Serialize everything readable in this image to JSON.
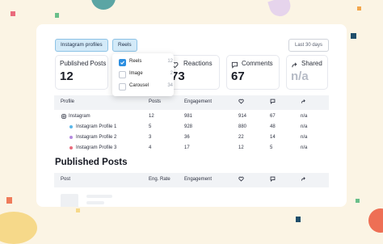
{
  "filters": {
    "account_chip": "Instagram profiles",
    "type_chip": "Reels",
    "date_range": "Last 30 days"
  },
  "stats": [
    {
      "label": "Published Posts",
      "value": "12"
    },
    {
      "label": "Reactions",
      "value": "73"
    },
    {
      "label": "Comments",
      "value": "67"
    },
    {
      "label": "Shared",
      "value": "n/a"
    }
  ],
  "profiles_table": {
    "headers": [
      "Profile",
      "Posts",
      "Engagement"
    ],
    "rows": [
      {
        "name": "Instagram",
        "posts": "12",
        "engagement": "981",
        "reactions": "914",
        "comments": "67",
        "shared": "n/a"
      },
      {
        "name": "Instagram Profile 1",
        "posts": "5",
        "engagement": "928",
        "reactions": "880",
        "comments": "48",
        "shared": "n/a"
      },
      {
        "name": "Instagram Profile 2",
        "posts": "3",
        "engagement": "36",
        "reactions": "22",
        "comments": "14",
        "shared": "n/a"
      },
      {
        "name": "Instagram Profile 3",
        "posts": "4",
        "engagement": "17",
        "reactions": "12",
        "comments": "5",
        "shared": "n/a"
      }
    ],
    "profile_colors": [
      "#5bb7ea",
      "#b58be0",
      "#ea6b7d"
    ]
  },
  "published_posts": {
    "title": "Published Posts",
    "headers": [
      "Post",
      "Eng. Rate",
      "Engagement"
    ]
  },
  "dropdown": {
    "options": [
      {
        "label": "Reels",
        "count": "12",
        "checked": true
      },
      {
        "label": "Image",
        "count": "2",
        "checked": false
      },
      {
        "label": "Carousel",
        "count": "34",
        "checked": false
      }
    ]
  },
  "icons": {
    "reactions": "heart-icon",
    "comments": "comment-icon",
    "shared": "share-arrow-icon",
    "profile": "instagram-icon",
    "checkbox": "checkmark-icon"
  }
}
